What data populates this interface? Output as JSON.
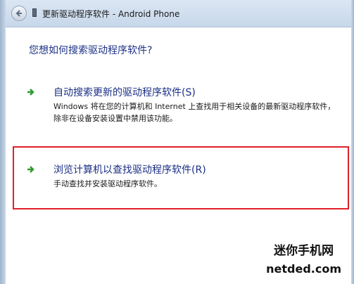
{
  "window": {
    "title": "更新驱动程序软件 - Android Phone"
  },
  "question": "您想如何搜索驱动程序软件?",
  "options": [
    {
      "title": "自动搜索更新的驱动程序软件(S)",
      "description": "Windows 将在您的计算机和 Internet 上查找用于相关设备的最新驱动程序软件，除非在设备安装设置中禁用该功能。"
    },
    {
      "title": "浏览计算机以查找驱动程序软件(R)",
      "description": "手动查找并安装驱动程序软件。"
    }
  ],
  "watermark": {
    "line1": "迷你手机网",
    "line2": "netded.com"
  },
  "colors": {
    "link_text": "#1a2e84",
    "arrow": "#2e9a2e",
    "highlight": "#e0202a"
  },
  "icons": {
    "back": "back-arrow-icon",
    "device": "phone-device-icon",
    "option": "green-arrow-icon"
  }
}
